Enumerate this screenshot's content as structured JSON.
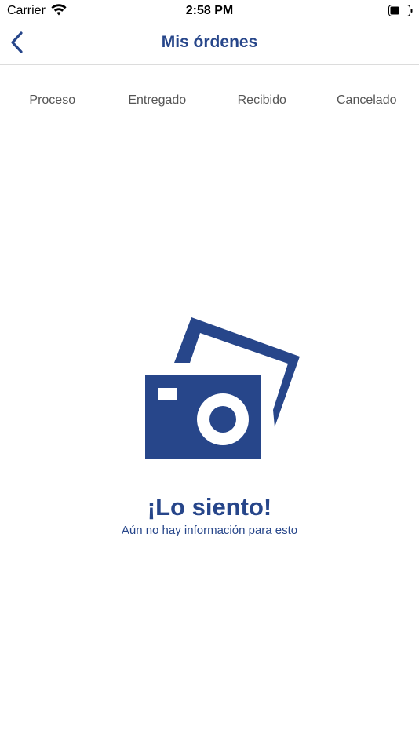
{
  "status_bar": {
    "carrier": "Carrier",
    "time": "2:58 PM",
    "wifi_icon": "wifi-icon",
    "battery_icon": "battery-icon"
  },
  "nav": {
    "title": "Mis órdenes",
    "back_icon": "chevron-left-icon"
  },
  "tabs": [
    {
      "label": "Proceso"
    },
    {
      "label": "Entregado"
    },
    {
      "label": "Recibido"
    },
    {
      "label": "Cancelado"
    }
  ],
  "empty_state": {
    "icon": "photo-camera-icon",
    "title": "¡Lo siento!",
    "subtitle": "Aún no hay información para esto"
  },
  "colors": {
    "brand": "#27468a",
    "tab_text": "#555555",
    "divider": "#dcdcdc"
  }
}
